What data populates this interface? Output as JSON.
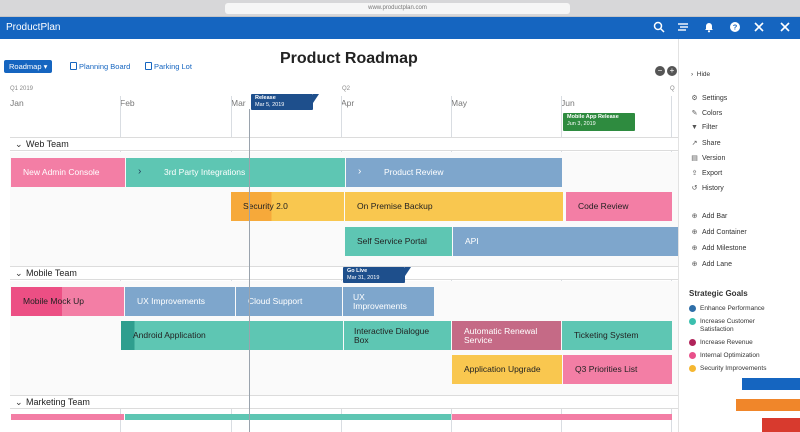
{
  "browser": {
    "url": "www.productplan.com"
  },
  "app": {
    "brand": "ProductPlan"
  },
  "title": "Product Roadmap",
  "views": {
    "active": "Roadmap ▾",
    "planning": "Planning Board",
    "parking": "Parking Lot"
  },
  "zoom": {
    "minus": "−",
    "plus": "+"
  },
  "timeline": {
    "quarters": [
      "Q1 2019",
      "Q2",
      "Q"
    ],
    "months": [
      "Jan",
      "Feb",
      "Mar",
      "Apr",
      "May",
      "Jun"
    ]
  },
  "milestones": {
    "release": {
      "title": "Release",
      "date": "Mar 5, 2019"
    },
    "golive": {
      "title": "Go Live",
      "date": "Mar 31, 2019"
    },
    "mobile_release": {
      "title": "Mobile App Release",
      "date": "Jun 3, 2019"
    }
  },
  "lanes": {
    "web": {
      "name": "Web Team",
      "bars": {
        "new_admin": "New Admin Console",
        "third_party": "3rd Party Integrations",
        "product_review": "Product Review",
        "security": "Security 2.0",
        "on_premise": "On Premise Backup",
        "code_review": "Code Review",
        "self_service": "Self Service Portal",
        "api": "API"
      }
    },
    "mobile": {
      "name": "Mobile Team",
      "bars": {
        "mock_up": "Mobile Mock Up",
        "ux1": "UX Improvements",
        "cloud": "Cloud Support",
        "ux2": "UX Improvements",
        "android": "Android Application",
        "interactive": "Interactive Dialogue Box",
        "renewal": "Automatic Renewal Service",
        "ticketing": "Ticketing System",
        "app_upgrade": "Application Upgrade",
        "q3": "Q3 Priorities List"
      }
    },
    "marketing": {
      "name": "Marketing Team"
    }
  },
  "panel": {
    "hide": "Hide",
    "settings": "Settings",
    "colors": "Colors",
    "filter": "Filter",
    "share": "Share",
    "version": "Version",
    "export": "Export",
    "history": "History",
    "add_bar": "Add Bar",
    "add_container": "Add Container",
    "add_milestone": "Add Milestone",
    "add_lane": "Add Lane"
  },
  "goals": {
    "title": "Strategic Goals",
    "items": [
      {
        "label": "Enhance Performance",
        "color": "#2f6fa8"
      },
      {
        "label": "Increase Customer Satisfaction",
        "color": "#3bbfae"
      },
      {
        "label": "Increase Revenue",
        "color": "#b0245a"
      },
      {
        "label": "Internal Optimization",
        "color": "#e8508a"
      },
      {
        "label": "Security Improvements",
        "color": "#f5b731"
      }
    ]
  },
  "colors": {
    "brand": "#1565c0",
    "pink": "#f37ea5",
    "teal": "#5ec6b3",
    "steel": "#7ea6cc",
    "yellow": "#f9c74f",
    "maroon": "#c56a86"
  }
}
